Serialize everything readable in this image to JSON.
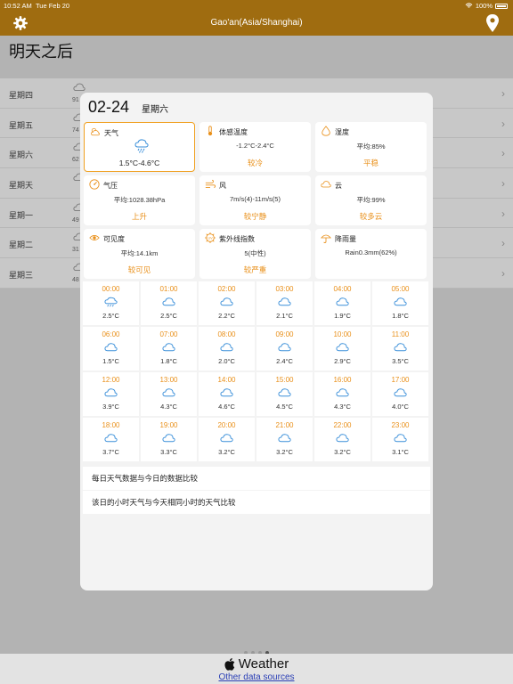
{
  "status_bar": {
    "time": "10:52 AM",
    "date": "Tue Feb 20",
    "battery": "100%"
  },
  "nav": {
    "title": "Gao'an(Asia/Shanghai)",
    "left_icon": "gear-icon",
    "right_icon": "location-pin-icon"
  },
  "background": {
    "title": "明天之后",
    "rows": [
      {
        "day": "星期四",
        "num": "91"
      },
      {
        "day": "星期五",
        "num": "74"
      },
      {
        "day": "星期六",
        "num": "62"
      },
      {
        "day": "星期天",
        "num": ""
      },
      {
        "day": "星期一",
        "num": "49"
      },
      {
        "day": "星期二",
        "num": "31"
      },
      {
        "day": "星期三",
        "num": "48"
      }
    ]
  },
  "detail": {
    "date": "02-24",
    "weekday": "星期六",
    "cards": [
      {
        "label": "天气",
        "icon": "cloud-icon",
        "value": "1.5°C-4.6°C",
        "main_icon": "rain-cloud-icon",
        "selected": true
      },
      {
        "label": "体感温度",
        "icon": "thermometer-icon",
        "value": "-1.2°C-2.4°C",
        "desc": "较冷"
      },
      {
        "label": "湿度",
        "icon": "droplet-icon",
        "value": "平均:85%",
        "desc": "平稳"
      },
      {
        "label": "气压",
        "icon": "gauge-icon",
        "value": "平均:1028.38hPa",
        "desc": "上升"
      },
      {
        "label": "风",
        "icon": "wind-icon",
        "value": "7m/s(4)-11m/s(5)",
        "desc": "较宁静"
      },
      {
        "label": "云",
        "icon": "cloud-icon",
        "value": "平均:99%",
        "desc": "较多云"
      },
      {
        "label": "可见度",
        "icon": "eye-icon",
        "value": "平均:14.1km",
        "desc": "较可见"
      },
      {
        "label": "紫外线指数",
        "icon": "uv-icon",
        "value": "5(中性)",
        "desc": "较严重"
      },
      {
        "label": "降雨量",
        "icon": "umbrella-icon",
        "value": "Rain0.3mm(62%)",
        "desc": ""
      }
    ],
    "hours": [
      {
        "time": "00:00",
        "temp": "2.5°C",
        "icon": "rain-cloud-icon"
      },
      {
        "time": "01:00",
        "temp": "2.5°C",
        "icon": "cloud-icon"
      },
      {
        "time": "02:00",
        "temp": "2.2°C",
        "icon": "cloud-icon"
      },
      {
        "time": "03:00",
        "temp": "2.1°C",
        "icon": "cloud-icon"
      },
      {
        "time": "04:00",
        "temp": "1.9°C",
        "icon": "cloud-icon"
      },
      {
        "time": "05:00",
        "temp": "1.8°C",
        "icon": "cloud-icon"
      },
      {
        "time": "06:00",
        "temp": "1.5°C",
        "icon": "cloud-icon"
      },
      {
        "time": "07:00",
        "temp": "1.8°C",
        "icon": "cloud-icon"
      },
      {
        "time": "08:00",
        "temp": "2.0°C",
        "icon": "cloud-icon"
      },
      {
        "time": "09:00",
        "temp": "2.4°C",
        "icon": "cloud-icon"
      },
      {
        "time": "10:00",
        "temp": "2.9°C",
        "icon": "cloud-icon"
      },
      {
        "time": "11:00",
        "temp": "3.5°C",
        "icon": "cloud-icon"
      },
      {
        "time": "12:00",
        "temp": "3.9°C",
        "icon": "cloud-icon"
      },
      {
        "time": "13:00",
        "temp": "4.3°C",
        "icon": "cloud-icon"
      },
      {
        "time": "14:00",
        "temp": "4.6°C",
        "icon": "cloud-icon"
      },
      {
        "time": "15:00",
        "temp": "4.5°C",
        "icon": "cloud-icon"
      },
      {
        "time": "16:00",
        "temp": "4.3°C",
        "icon": "cloud-icon"
      },
      {
        "time": "17:00",
        "temp": "4.0°C",
        "icon": "cloud-icon"
      },
      {
        "time": "18:00",
        "temp": "3.7°C",
        "icon": "cloud-icon"
      },
      {
        "time": "19:00",
        "temp": "3.3°C",
        "icon": "cloud-icon"
      },
      {
        "time": "20:00",
        "temp": "3.2°C",
        "icon": "cloud-icon"
      },
      {
        "time": "21:00",
        "temp": "3.2°C",
        "icon": "cloud-icon"
      },
      {
        "time": "22:00",
        "temp": "3.2°C",
        "icon": "cloud-icon"
      },
      {
        "time": "23:00",
        "temp": "3.1°C",
        "icon": "cloud-icon"
      }
    ],
    "compare_daily": "每日天气数据与今日的数据比较",
    "compare_hourly": "该日的小时天气与今天相同小时的天气比较"
  },
  "footer": {
    "brand": "Weather",
    "link": "Other data sources"
  },
  "colors": {
    "accent": "#9f6c10",
    "highlight": "#e9901a",
    "icon_blue": "#3a8fd9"
  }
}
